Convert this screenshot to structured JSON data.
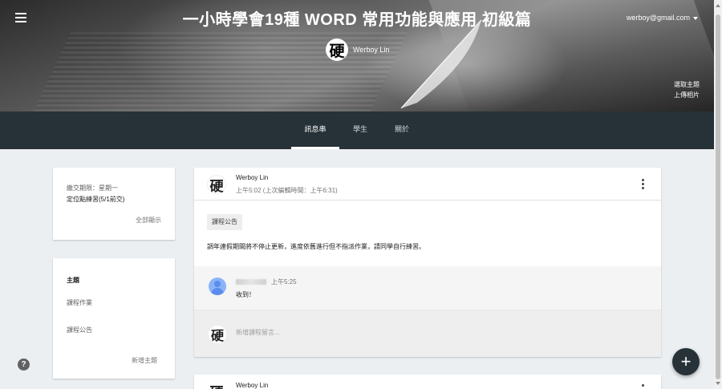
{
  "header": {
    "title": "一小時學會19種 WORD 常用功能與應用 初級篇",
    "account_email": "werboy@gmail.com",
    "teacher_avatar_char": "硬",
    "teacher_name": "Werboy Lin",
    "select_theme": "選取主題",
    "upload_photo": "上傳相片"
  },
  "tabs": [
    {
      "label": "訊息串",
      "active": true
    },
    {
      "label": "學生",
      "active": false
    },
    {
      "label": "關於",
      "active": false
    }
  ],
  "due_card": {
    "title": "繳交期限：星期一",
    "item": "定位點練習(5/1前交)",
    "view_all": "全部顯示"
  },
  "topics": {
    "heading": "主題",
    "items": [
      "課程作業",
      "課程公告"
    ],
    "add": "新增主題"
  },
  "post": {
    "avatar_char": "硬",
    "author": "Werboy Lin",
    "time": "上午5:02 (上次編輯時間：上午6:31)",
    "tag": "課程公告",
    "body": "調年連假期間將不停止更新，進度依舊進行但不指派作業，請同學自行練習。",
    "comment": {
      "time": "上午5:25",
      "text": "收到！"
    },
    "reply_avatar_char": "硬",
    "reply_placeholder": "新增課程留言..."
  },
  "post2": {
    "avatar_char": "硬",
    "author": "Werboy Lin"
  },
  "help_label": "?",
  "fab_label": "+",
  "colors": {
    "tabbar": "#263238",
    "background": "#eceff1",
    "fab": "#263238"
  }
}
